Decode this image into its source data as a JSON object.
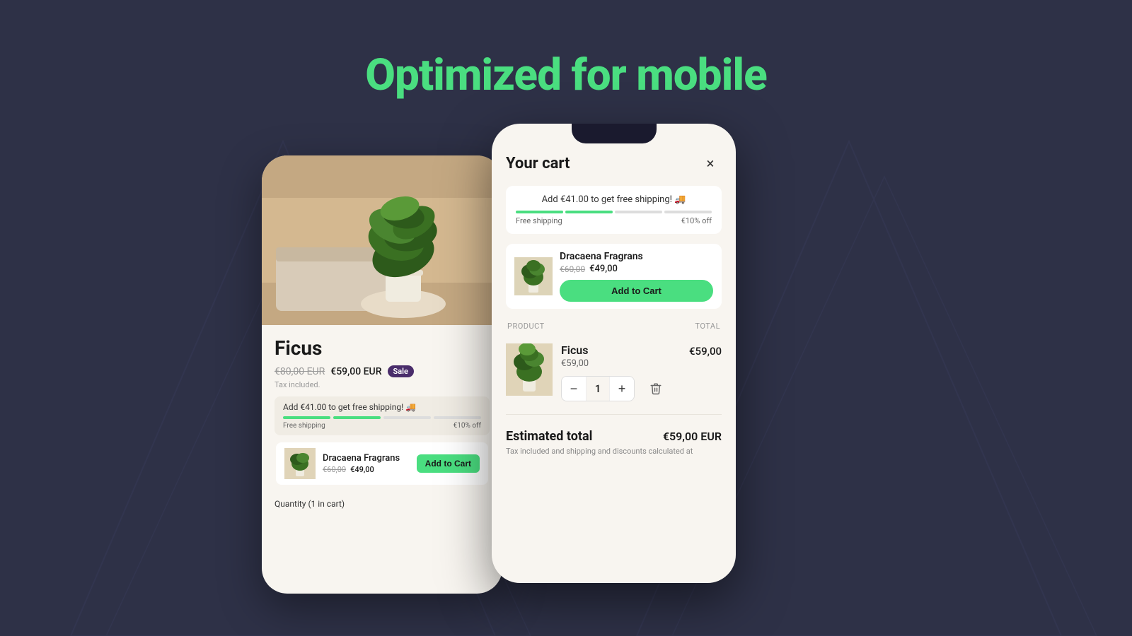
{
  "page": {
    "title": "Optimized for mobile",
    "background_color": "#2e3147",
    "title_color": "#4ade80"
  },
  "left_phone": {
    "product_name": "Ficus",
    "original_price": "€80,00 EUR",
    "sale_price": "€59,00 EUR",
    "sale_badge": "Sale",
    "tax_note": "Tax included.",
    "shipping_banner_text": "Add €41.00 to get free shipping! 🚚",
    "progress_label_left": "Free shipping",
    "progress_label_right": "€10% off",
    "upsell_name": "Dracaena Fragrans",
    "upsell_original": "€60,00",
    "upsell_sale": "€49,00",
    "add_to_cart_label": "Add to Cart",
    "quantity_label": "Quantity (1 in cart)"
  },
  "right_phone": {
    "cart_title": "Your cart",
    "close_icon": "×",
    "shipping_text": "Add €41.00 to get free shipping! 🚚",
    "progress_label_left": "Free shipping",
    "progress_label_right": "€10% off",
    "upsell_name": "Dracaena Fragrans",
    "upsell_original": "€60,00",
    "upsell_sale": "€49,00",
    "add_to_cart_label": "Add to Cart",
    "col_product": "PRODUCT",
    "col_total": "TOTAL",
    "item_name": "Ficus",
    "item_price": "€59,00",
    "item_total": "€59,00",
    "item_quantity": "1",
    "estimated_label": "Estimated total",
    "estimated_value": "€59,00 EUR",
    "estimated_note": "Tax included and shipping and discounts calculated at"
  }
}
